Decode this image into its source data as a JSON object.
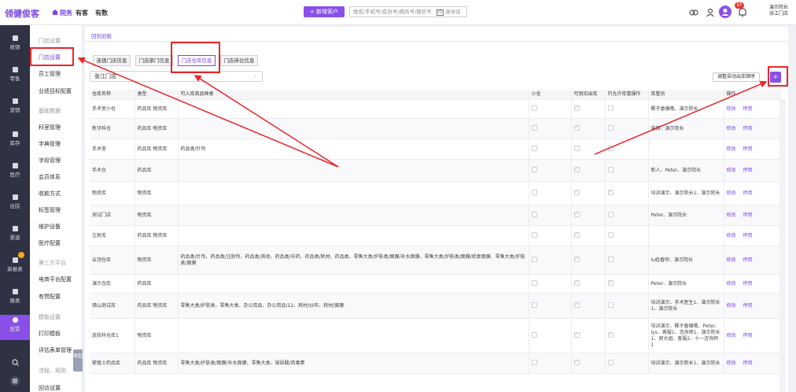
{
  "brand": "领健俊客",
  "top_nav": [
    {
      "label": "院务",
      "active": true
    },
    {
      "label": "有客",
      "active": false
    },
    {
      "label": "有数",
      "active": false
    }
  ],
  "new_customer_label": "+ 新增客户",
  "search_placeholder": "姓名/手机号/会员号/病历号/微信号",
  "id_card_label": "身份证",
  "notification_count": "67",
  "user": {
    "name": "演示院长",
    "clinic": "张江门店"
  },
  "rail": [
    {
      "label": "收银",
      "icon": "cash-register-icon"
    },
    {
      "label": "零售",
      "icon": "shopping-bag-icon"
    },
    {
      "label": "营销",
      "icon": "megaphone-icon"
    },
    {
      "label": "库存",
      "icon": "warehouse-icon"
    },
    {
      "label": "医疗",
      "icon": "medical-icon"
    },
    {
      "label": "住院",
      "icon": "bed-icon"
    },
    {
      "label": "渠道",
      "icon": "channel-icon"
    },
    {
      "label": "新报表",
      "icon": "new-report-icon"
    },
    {
      "label": "报表",
      "icon": "report-icon"
    },
    {
      "label": "配置",
      "icon": "settings-icon"
    }
  ],
  "rail_bottom": [
    "search-icon",
    "menu-icon"
  ],
  "submenu": [
    {
      "label": "门店设置",
      "type": "group"
    },
    {
      "label": "门店设置",
      "type": "active"
    },
    {
      "label": "员工管理",
      "type": "item"
    },
    {
      "label": "业绩目标配置",
      "type": "item"
    },
    {
      "label": "基础数据",
      "type": "group"
    },
    {
      "label": "科室管理",
      "type": "item"
    },
    {
      "label": "字典管理",
      "type": "item"
    },
    {
      "label": "字段管理",
      "type": "item"
    },
    {
      "label": "会员体系",
      "type": "item"
    },
    {
      "label": "收款方式",
      "type": "item"
    },
    {
      "label": "标签管理",
      "type": "item"
    },
    {
      "label": "维护设备",
      "type": "item"
    },
    {
      "label": "医疗配置",
      "type": "item"
    },
    {
      "label": "第三方平台",
      "type": "group"
    },
    {
      "label": "电商平台配置",
      "type": "item"
    },
    {
      "label": "有赞配置",
      "type": "item"
    },
    {
      "label": "模板设置",
      "type": "group"
    },
    {
      "label": "打印模板",
      "type": "item"
    },
    {
      "label": "评估表单管理",
      "type": "item"
    },
    {
      "label": "流程、规则",
      "type": "group"
    },
    {
      "label": "回访设置",
      "type": "item"
    }
  ],
  "collapse_label": "收起",
  "breadcrumb": "回到旧版",
  "tabs": [
    {
      "label": "连锁门店信息",
      "active": false
    },
    {
      "label": "门店部门信息",
      "active": false
    },
    {
      "label": "门店仓库信息",
      "active": true
    },
    {
      "label": "门店床位信息",
      "active": false
    }
  ],
  "store_select": "张江门店",
  "adjust_btn": "调整自动出库顺序",
  "add_btn": "+",
  "columns": [
    "仓库名称",
    "类型",
    "可入库商品种类",
    "小仓",
    "可划扣出库",
    "只允许库管操作",
    "库管员",
    "操作"
  ],
  "rows": [
    {
      "name": "手术室小仓",
      "type": "药品库 物资库",
      "goods": "",
      "small": false,
      "deduct": true,
      "only_admin": false,
      "keepers": "椰子香偏哦、演示院长",
      "actions": [
        "修改",
        "停用"
      ]
    },
    {
      "name": "新牙科仓",
      "type": "药品库 物资库",
      "goods": "",
      "small": false,
      "deduct": true,
      "only_admin": false,
      "keepers": "电网、演示院长",
      "actions": [
        "修改",
        "停用"
      ]
    },
    {
      "name": "手术室",
      "type": "药品库 物资库",
      "goods": "药品类/针剂",
      "small": false,
      "deduct": false,
      "only_admin": false,
      "keepers": "",
      "actions": [
        "修改",
        "停用"
      ]
    },
    {
      "name": "手术仓",
      "type": "药品库",
      "goods": "",
      "small": false,
      "deduct": true,
      "only_admin": false,
      "keepers": "新人、Peter、演示院长",
      "actions": [
        "修改",
        "停用"
      ]
    },
    {
      "name": "物资库",
      "type": "物资库",
      "goods": "",
      "small": false,
      "deduct": true,
      "only_admin": true,
      "keepers": "培训演示、演示院长1、演示院长",
      "actions": [
        "修改",
        "停用"
      ]
    },
    {
      "name": "测试门店",
      "type": "物资库",
      "goods": "",
      "small": false,
      "deduct": true,
      "only_admin": false,
      "keepers": "Peter、演示院长",
      "actions": [
        "修改",
        "停用"
      ]
    },
    {
      "name": "注射库",
      "type": "药品库 物资库",
      "goods": "",
      "small": false,
      "deduct": true,
      "only_admin": false,
      "keepers": "",
      "actions": [
        "修改",
        "停用"
      ]
    },
    {
      "name": "云顶仓库",
      "type": "物资库",
      "goods": "药品类/针剂、药品类/注射剂、药品类/其他、药品类/中药、药品类/耗材、药品类、零售大类/护肤类/面膜/补水面膜、零售大类/护肤类/面膜/修复面膜、零售大类/护肤类/面膜",
      "small": false,
      "deduct": true,
      "only_admin": false,
      "keepers": "lu姓香师、演示院长",
      "actions": [
        "修改",
        "停用"
      ]
    },
    {
      "name": "演示仓库",
      "type": "药品库",
      "goods": "",
      "small": false,
      "deduct": true,
      "only_admin": true,
      "keepers": "Peter、演示院长",
      "actions": [
        "修改",
        "停用"
      ]
    },
    {
      "name": "佛山测试库",
      "type": "药品库 物资库",
      "goods": "零售大类/护肤类、零售大类、办公用品、办公用品/12、耗材/纱布、耗材/面膜",
      "small": false,
      "deduct": true,
      "only_admin": false,
      "keepers": "培训演示、手术医生1、演示院长1、演示院长",
      "actions": [
        "修改",
        "停用"
      ]
    },
    {
      "name": "皮肤科仓库1",
      "type": "物资库",
      "goods": "",
      "small": false,
      "deduct": true,
      "only_admin": true,
      "keepers": "培训演示、椰子香偏哦、Peter、lys、客服1、咨询师1、演示院长1、郭大姐、客服2、十一咨询师1",
      "actions": [
        "修改",
        "停用"
      ]
    },
    {
      "name": "繁殖士药品库",
      "type": "药品库 物资库",
      "goods": "零售大类/护肤类/面膜/补水面膜、零售大类、玻尿酸/肉毒素",
      "small": false,
      "deduct": true,
      "only_admin": false,
      "keepers": "培训演示、演示院长1、演示院长",
      "actions": [
        "修改",
        "停用"
      ]
    }
  ]
}
